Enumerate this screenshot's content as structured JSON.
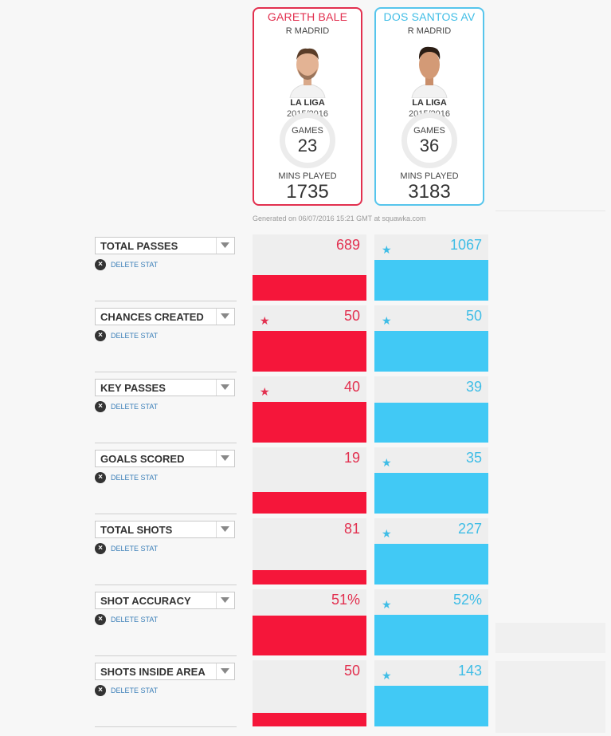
{
  "players": [
    {
      "name": "GARETH BALE",
      "club": "R MADRID",
      "league": "LA LIGA",
      "season": "2015/2016",
      "games_label": "GAMES",
      "games": "23",
      "mins_label": "MINS PLAYED",
      "mins": "1735",
      "color": "#e2304f"
    },
    {
      "name": "DOS SANTOS AV",
      "club": "R MADRID",
      "league": "LA LIGA",
      "season": "2015/2016",
      "games_label": "GAMES",
      "games": "36",
      "mins_label": "MINS PLAYED",
      "mins": "3183",
      "color": "#3fbde6"
    }
  ],
  "generated_text": "Generated on 06/07/2016 15:21 GMT at squawka.com",
  "delete_label": "DELETE STAT",
  "stats": [
    {
      "label": "TOTAL PASSES",
      "p1": "689",
      "p2": "1067",
      "p1_star": false,
      "p2_star": true,
      "p1_fill": 0.65,
      "p2_fill": 1.0
    },
    {
      "label": "CHANCES CREATED",
      "p1": "50",
      "p2": "50",
      "p1_star": true,
      "p2_star": true,
      "p1_fill": 1.0,
      "p2_fill": 1.0
    },
    {
      "label": "KEY PASSES",
      "p1": "40",
      "p2": "39",
      "p1_star": true,
      "p2_star": false,
      "p1_fill": 1.0,
      "p2_fill": 0.98
    },
    {
      "label": "GOALS SCORED",
      "p1": "19",
      "p2": "35",
      "p1_star": false,
      "p2_star": true,
      "p1_fill": 0.54,
      "p2_fill": 1.0
    },
    {
      "label": "TOTAL SHOTS",
      "p1": "81",
      "p2": "227",
      "p1_star": false,
      "p2_star": true,
      "p1_fill": 0.36,
      "p2_fill": 1.0
    },
    {
      "label": "SHOT ACCURACY",
      "p1": "51%",
      "p2": "52%",
      "p1_star": false,
      "p2_star": true,
      "p1_fill": 0.98,
      "p2_fill": 1.0
    },
    {
      "label": "SHOTS INSIDE AREA",
      "p1": "50",
      "p2": "143",
      "p1_star": false,
      "p2_star": true,
      "p1_fill": 0.35,
      "p2_fill": 1.0
    }
  ]
}
